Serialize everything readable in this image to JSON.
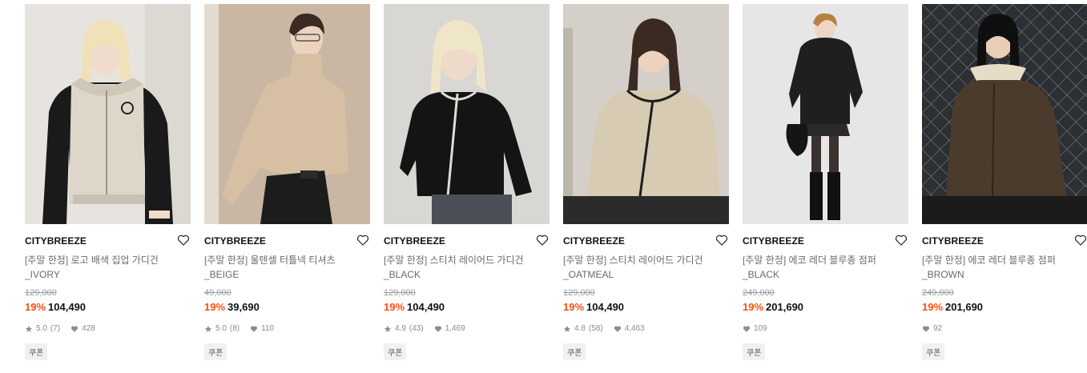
{
  "colors": {
    "discount": "#ff4e0e",
    "muted": "#8c8c8c",
    "brand": "#111111"
  },
  "products": [
    {
      "brand": "CITYBREEZE",
      "title_line1": "[주말 한정] 로고 배색 집업 가디건",
      "title_line2": "_IVORY",
      "original_price": "129,000",
      "discount": "19%",
      "price": "104,490",
      "rating": "5.0",
      "reviews": "(7)",
      "likes": "428",
      "coupon": "쿠폰",
      "image": "ivory-zip-cardigan-photo"
    },
    {
      "brand": "CITYBREEZE",
      "title_line1": "[주말 한정] 울텐셀 터틀넥 티셔츠",
      "title_line2": "_BEIGE",
      "original_price": "49,000",
      "discount": "19%",
      "price": "39,690",
      "rating": "5.0",
      "reviews": "(8)",
      "likes": "110",
      "coupon": "쿠폰",
      "image": "beige-turtleneck-photo"
    },
    {
      "brand": "CITYBREEZE",
      "title_line1": "[주말 한정] 스티치 레이어드 가디건",
      "title_line2": "_BLACK",
      "original_price": "129,000",
      "discount": "19%",
      "price": "104,490",
      "rating": "4.9",
      "reviews": "(43)",
      "likes": "1,469",
      "coupon": "쿠폰",
      "image": "black-stitch-cardigan-photo"
    },
    {
      "brand": "CITYBREEZE",
      "title_line1": "[주말 한정] 스티치 레이어드 가디건",
      "title_line2": "_OATMEAL",
      "original_price": "129,000",
      "discount": "19%",
      "price": "104,490",
      "rating": "4.8",
      "reviews": "(58)",
      "likes": "4,463",
      "coupon": "쿠폰",
      "image": "oatmeal-stitch-cardigan-photo"
    },
    {
      "brand": "CITYBREEZE",
      "title_line1": "[주말 한정] 에코 레더 블루종 점퍼",
      "title_line2": "_BLACK",
      "original_price": "249,000",
      "discount": "19%",
      "price": "201,690",
      "rating": "",
      "reviews": "",
      "likes": "109",
      "coupon": "쿠폰",
      "image": "black-leather-blouson-photo"
    },
    {
      "brand": "CITYBREEZE",
      "title_line1": "[주말 한정] 에코 레더 블루종 점퍼",
      "title_line2": "_BROWN",
      "original_price": "249,000",
      "discount": "19%",
      "price": "201,690",
      "rating": "",
      "reviews": "",
      "likes": "92",
      "coupon": "쿠폰",
      "image": "brown-leather-blouson-photo"
    }
  ]
}
